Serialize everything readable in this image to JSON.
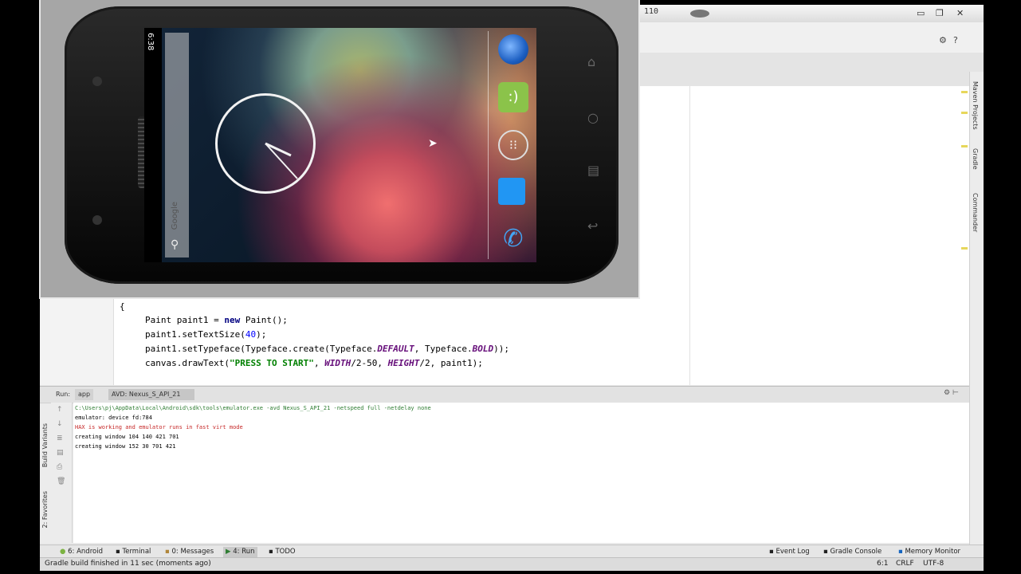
{
  "ide": {
    "version_fragment": "110",
    "editor_lines": [
      {
        "plain": "Paint paint1 = ",
        "kw": "new",
        "rest": " Paint();"
      },
      {
        "a": "paint1.setTextSize(",
        "num": "40",
        "b": ");"
      },
      {
        "a": "paint1.setTypeface(Typeface.create(Typeface.",
        "c1": "DEFAULT",
        "b": ", Typeface.",
        "c2": "BOLD",
        "end": "));"
      },
      {
        "a": "canvas.drawText(",
        "str": "\"PRESS TO START\"",
        "b": ", ",
        "c1": "WIDTH",
        "mid": "/2-50, ",
        "c2": "HEIGHT",
        "end": "/2, paint1);"
      }
    ],
    "right_tool_windows": [
      "Maven Projects",
      "Gradle",
      "Commander"
    ],
    "left_tool_windows": [
      "Build Variants",
      "2: Favorites"
    ],
    "run_panel": {
      "label": "Run:",
      "tabs": [
        "app",
        "AVD: Nexus_S_API_21"
      ],
      "console_lines": [
        {
          "text": "C:\\Users\\pj\\AppData\\Local\\Android\\sdk\\tools\\emulator.exe -avd Nexus_S_API_21 -netspeed full -netdelay none",
          "color": "#2e7d32"
        },
        {
          "text": "emulator: device fd:784",
          "color": "#000000"
        },
        {
          "text": "HAX is working and emulator runs in fast virt mode",
          "color": "#c62828"
        },
        {
          "text": "creating window 104 140 421 701",
          "color": "#000000"
        },
        {
          "text": "creating window 152 30 701 421",
          "color": "#000000"
        }
      ]
    },
    "bottom_tabs": [
      "6: Android",
      "Terminal",
      "0: Messages",
      "4: Run",
      "TODO"
    ],
    "bottom_right_tabs": [
      "Event Log",
      "Gradle Console",
      "Memory Monitor"
    ],
    "status": {
      "message": "Gradle build finished in 11 sec (moments ago)",
      "position": "6:1",
      "line_sep": "CRLF",
      "encoding": "UTF-8"
    }
  },
  "emulator": {
    "time": "6:38",
    "search_label": "Google",
    "dock_icons": [
      "browser-icon",
      "messaging-icon",
      "apps-icon",
      "contacts-icon",
      "phone-icon"
    ],
    "nav_buttons": [
      "home-icon",
      "search-icon",
      "menu-icon",
      "back-icon"
    ]
  },
  "colors": {
    "editor_bg": "#ffffff",
    "keyword": "#000080",
    "string": "#008000",
    "constant": "#660e7a",
    "number": "#0000ff"
  }
}
